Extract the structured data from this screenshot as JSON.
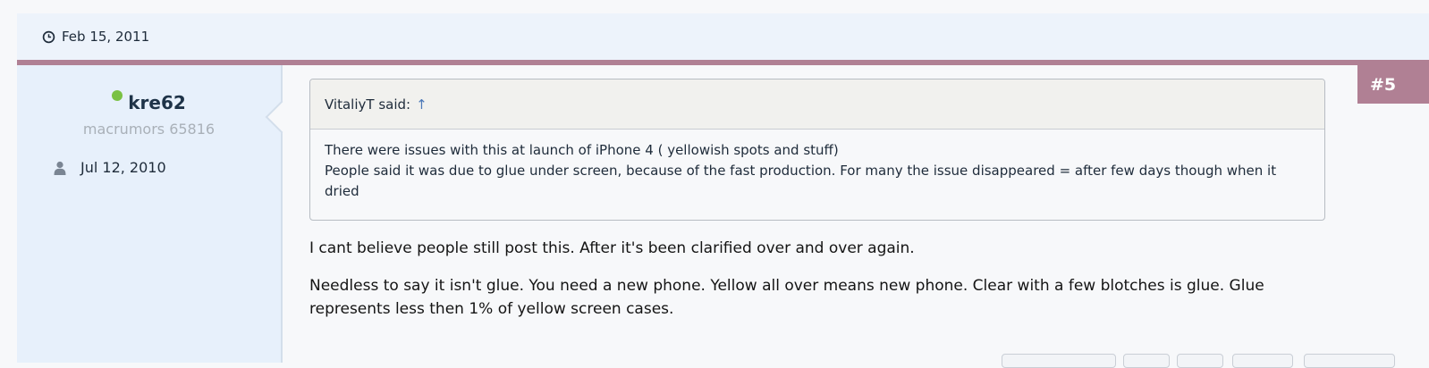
{
  "post": {
    "date": "Feb 15, 2011",
    "number": "#5"
  },
  "user": {
    "name": "kre62",
    "title": "macrumors 65816",
    "joined": "Jul 12, 2010",
    "online_status_color": "#7ac143"
  },
  "quote": {
    "author_line": "VitaliyT said:",
    "arrow": "↑",
    "lines": [
      "There were issues with this at launch of iPhone 4 ( yellowish spots and stuff)",
      "People said it was due to glue under screen, because of the fast production. For many the issue disappeared = after few days though when it dried"
    ]
  },
  "message": {
    "paragraphs": [
      "I cant believe people still post this. After it's been clarified over and over again.",
      "Needless to say it isn't glue. You need a new phone. Yellow all over means new phone. Clear with a few blotches is glue. Glue represents less then 1% of yellow screen cases."
    ]
  },
  "colors": {
    "accent": "#b08094",
    "header_bg": "#edf3fb",
    "user_panel_bg": "#e7f0fb"
  },
  "icons": {
    "date": "clock-icon",
    "joined": "person-icon"
  }
}
